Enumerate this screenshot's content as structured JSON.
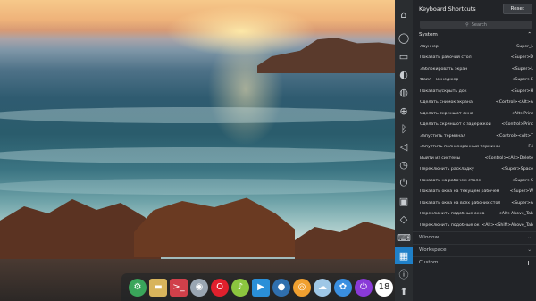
{
  "panel": {
    "title": "Keyboard Shortcuts",
    "reset_label": "Reset",
    "search_placeholder": "Search",
    "system_label": "System",
    "shortcuts": [
      {
        "label": "Лаунчер",
        "key": "Super_L"
      },
      {
        "label": "Показать рабочий стол",
        "key": "<Super>D"
      },
      {
        "label": "Заблокировать экран",
        "key": "<Super>L"
      },
      {
        "label": "Файл - менеджер",
        "key": "<Super>E"
      },
      {
        "label": "Показать/скрыть док",
        "key": "<Super>H"
      },
      {
        "label": "Сделать снимок экрана",
        "key": "<Control><Alt>A"
      },
      {
        "label": "Сделать скриншот окна",
        "key": "<Alt>Print"
      },
      {
        "label": "Сделать скриншот с задержкой",
        "key": "<Control>Print"
      },
      {
        "label": "Запустить терминал",
        "key": "<Control><Alt>T"
      },
      {
        "label": "Запустить полноэкранный терминал",
        "key": "F4"
      },
      {
        "label": "Выйти из системы",
        "key": "<Control><Alt>Delete"
      },
      {
        "label": "Переключить раскладку",
        "key": "<Super>Space"
      },
      {
        "label": "Показать на рабочем столе",
        "key": "<Super>S"
      },
      {
        "label": "Показать окна на текущем рабочем ст",
        "key": "<Super>W"
      },
      {
        "label": "Показать окна на всех рабочих столах",
        "key": "<Super>A"
      },
      {
        "label": "Переключить подобные окна",
        "key": "<Alt>Above_Tab"
      },
      {
        "label": "Переключить подобные ок",
        "key": "<Alt><Shift>Above_Tab"
      }
    ],
    "window_label": "Window",
    "workspace_label": "Workspace",
    "custom_label": "Custom"
  },
  "icon_strip": [
    "home-icon",
    "user-icon",
    "display-icon",
    "palette-icon",
    "sound-wave-icon",
    "network-icon",
    "bluetooth-icon",
    "speaker-icon",
    "clock-icon",
    "power-icon",
    "mouse-icon",
    "keyboard-layout-icon",
    "keyboard-icon",
    "shortcut-icon",
    "info-icon",
    "update-icon"
  ],
  "dock": {
    "items": [
      {
        "name": "launcher-icon",
        "glyph": "⚙",
        "color": "#3aa55a"
      },
      {
        "name": "files-icon",
        "glyph": "▬",
        "color": "#d8b45c"
      },
      {
        "name": "terminal-icon",
        "glyph": ">_",
        "color": "#d0404a"
      },
      {
        "name": "settings-icon",
        "glyph": "◉",
        "color": "#9aa6b2"
      },
      {
        "name": "opera-icon",
        "glyph": "O",
        "color": "#e0202d"
      },
      {
        "name": "music-icon",
        "glyph": "♪",
        "color": "#8cc63f"
      },
      {
        "name": "video-icon",
        "glyph": "▶",
        "color": "#2a8fd8"
      },
      {
        "name": "toggle-icon",
        "glyph": "●",
        "color": "#2f6fae"
      },
      {
        "name": "browser-icon",
        "glyph": "◎",
        "color": "#f0a030"
      },
      {
        "name": "weather-icon",
        "glyph": "☁",
        "color": "#9ec7e6"
      },
      {
        "name": "network-tray-icon",
        "glyph": "✿",
        "color": "#3a8fe0"
      },
      {
        "name": "power-tray-icon",
        "glyph": "⏻",
        "color": "#8a3ad8"
      },
      {
        "name": "clock-tray-icon",
        "glyph": "18",
        "color": "#ffffff"
      }
    ]
  }
}
